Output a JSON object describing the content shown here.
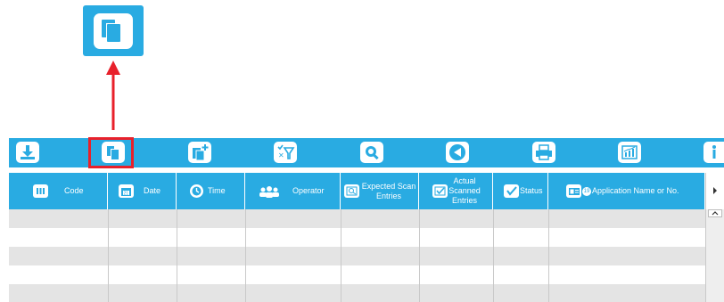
{
  "callout": {
    "icon": "copy-icon"
  },
  "toolbar": {
    "buttons": [
      {
        "name": "download",
        "icon": "download-icon"
      },
      {
        "name": "copy",
        "icon": "copy-icon",
        "highlighted": true
      },
      {
        "name": "add-copy",
        "icon": "add-copy-icon"
      },
      {
        "name": "filter",
        "icon": "filter-icon"
      },
      {
        "name": "search",
        "icon": "search-icon"
      },
      {
        "name": "back",
        "icon": "back-arrow-icon"
      },
      {
        "name": "print",
        "icon": "printer-icon"
      },
      {
        "name": "report",
        "icon": "chart-icon"
      },
      {
        "name": "info",
        "icon": "info-icon"
      }
    ]
  },
  "table": {
    "columns": [
      {
        "key": "code",
        "label": "Code",
        "icon": "barcode-icon"
      },
      {
        "key": "date",
        "label": "Date",
        "icon": "calendar-icon"
      },
      {
        "key": "time",
        "label": "Time",
        "icon": "clock-icon"
      },
      {
        "key": "operator",
        "label": "Operator",
        "icon": "users-icon"
      },
      {
        "key": "expected",
        "label": "Expected Scan Entries",
        "icon": "scan-list-icon"
      },
      {
        "key": "actual",
        "label": "Actual Scanned Entries",
        "icon": "checklist-icon"
      },
      {
        "key": "status",
        "label": "Status",
        "icon": "checkbox-icon"
      },
      {
        "key": "application",
        "label": "Application Name or No.",
        "icon": "id-card-icon"
      }
    ],
    "rows": [
      [],
      [],
      [],
      [],
      []
    ]
  },
  "colors": {
    "accent": "#29abe2",
    "highlight": "#e8212b",
    "row_shade": "#e4e4e4"
  }
}
